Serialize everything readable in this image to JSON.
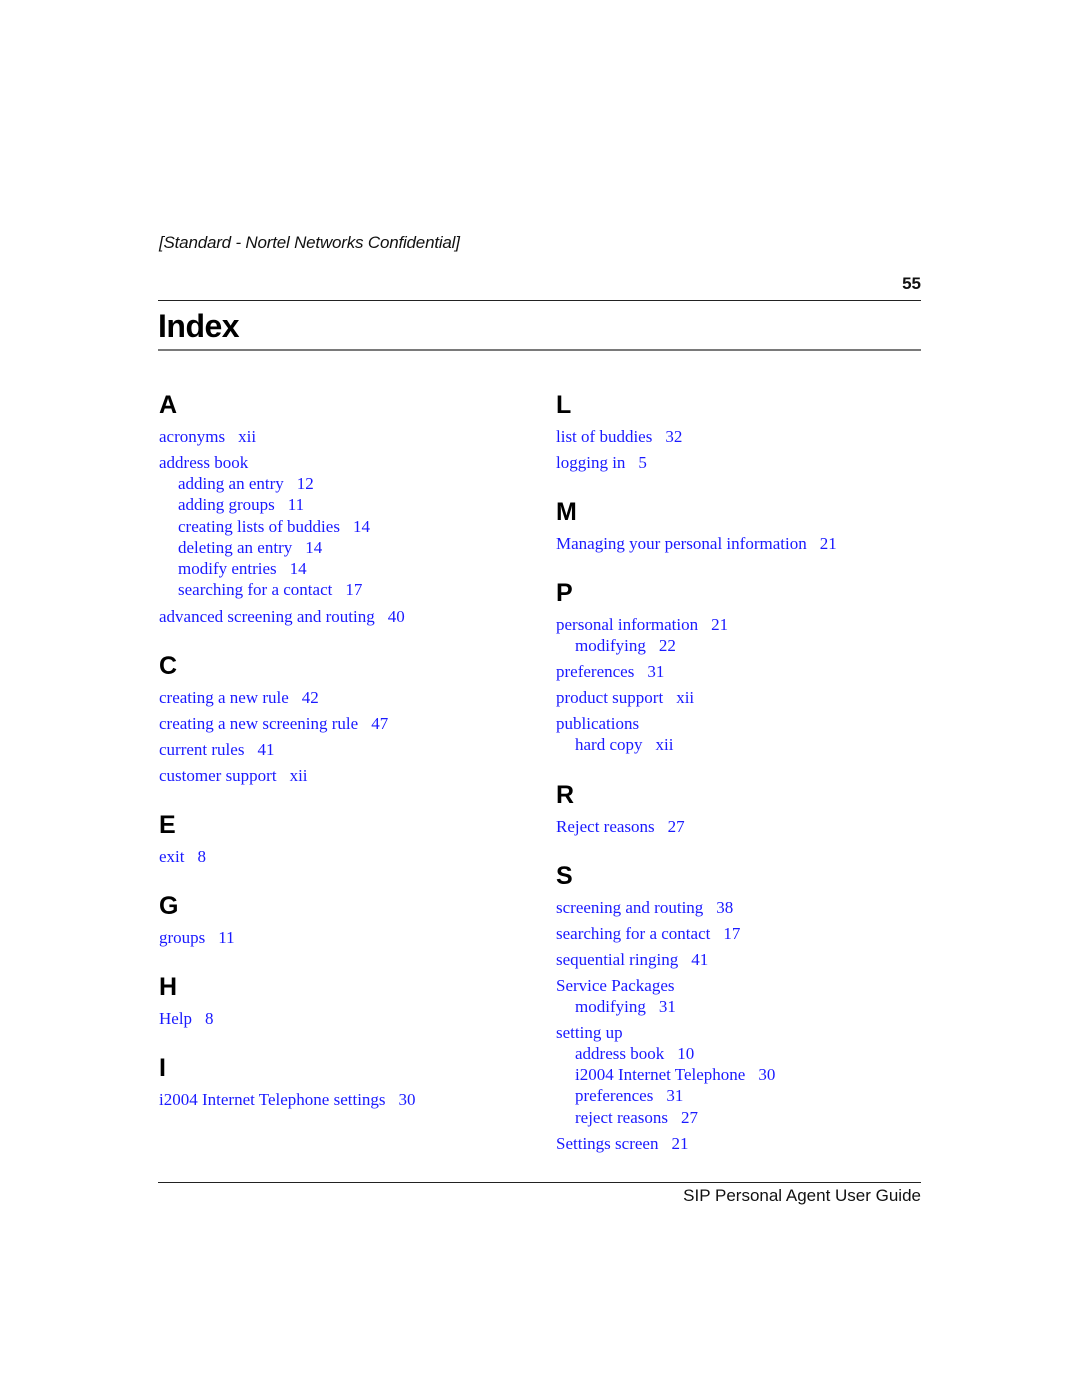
{
  "header": {
    "confidential": "[Standard - Nortel Networks Confidential]",
    "page_number": "55",
    "title": "Index"
  },
  "footer": {
    "guide_title": "SIP Personal Agent User Guide"
  },
  "colors": {
    "link": "#1a1aff",
    "heading": "#000000"
  },
  "left_column": [
    {
      "letter": "A",
      "entries": [
        {
          "term": "acronyms",
          "page": "xii",
          "subs": []
        },
        {
          "term": "address book",
          "page": "",
          "subs": [
            {
              "term": "adding an entry",
              "page": "12"
            },
            {
              "term": "adding groups",
              "page": "11"
            },
            {
              "term": "creating lists of buddies",
              "page": "14"
            },
            {
              "term": "deleting an entry",
              "page": "14"
            },
            {
              "term": "modify entries",
              "page": "14"
            },
            {
              "term": "searching for a contact",
              "page": "17"
            }
          ]
        },
        {
          "term": "advanced screening and routing",
          "page": "40",
          "subs": []
        }
      ]
    },
    {
      "letter": "C",
      "entries": [
        {
          "term": "creating a new rule",
          "page": "42",
          "subs": []
        },
        {
          "term": "creating a new screening rule",
          "page": "47",
          "subs": []
        },
        {
          "term": "current rules",
          "page": "41",
          "subs": []
        },
        {
          "term": "customer support",
          "page": "xii",
          "subs": []
        }
      ]
    },
    {
      "letter": "E",
      "entries": [
        {
          "term": "exit",
          "page": "8",
          "subs": []
        }
      ]
    },
    {
      "letter": "G",
      "entries": [
        {
          "term": "groups",
          "page": "11",
          "subs": []
        }
      ]
    },
    {
      "letter": "H",
      "entries": [
        {
          "term": "Help",
          "page": "8",
          "subs": []
        }
      ]
    },
    {
      "letter": "I",
      "entries": [
        {
          "term": "i2004 Internet Telephone settings",
          "page": "30",
          "subs": []
        }
      ]
    }
  ],
  "right_column": [
    {
      "letter": "L",
      "entries": [
        {
          "term": "list of buddies",
          "page": "32",
          "subs": []
        },
        {
          "term": "logging in",
          "page": "5",
          "subs": []
        }
      ]
    },
    {
      "letter": "M",
      "entries": [
        {
          "term": "Managing your personal information",
          "page": "21",
          "subs": []
        }
      ]
    },
    {
      "letter": "P",
      "entries": [
        {
          "term": "personal information",
          "page": "21",
          "subs": [
            {
              "term": "modifying",
              "page": "22"
            }
          ]
        },
        {
          "term": "preferences",
          "page": "31",
          "subs": []
        },
        {
          "term": "product support",
          "page": "xii",
          "subs": []
        },
        {
          "term": "publications",
          "page": "",
          "subs": [
            {
              "term": "hard copy",
              "page": "xii"
            }
          ]
        }
      ]
    },
    {
      "letter": "R",
      "entries": [
        {
          "term": "Reject reasons",
          "page": "27",
          "subs": []
        }
      ]
    },
    {
      "letter": "S",
      "entries": [
        {
          "term": "screening and routing",
          "page": "38",
          "subs": []
        },
        {
          "term": "searching for a contact",
          "page": "17",
          "subs": []
        },
        {
          "term": "sequential ringing",
          "page": "41",
          "subs": []
        },
        {
          "term": "Service Packages",
          "page": "",
          "subs": [
            {
              "term": "modifying",
              "page": "31"
            }
          ]
        },
        {
          "term": "setting up",
          "page": "",
          "subs": [
            {
              "term": "address book",
              "page": "10"
            },
            {
              "term": "i2004 Internet Telephone",
              "page": "30"
            },
            {
              "term": "preferences",
              "page": "31"
            },
            {
              "term": "reject reasons",
              "page": "27"
            }
          ]
        },
        {
          "term": "Settings screen",
          "page": "21",
          "subs": []
        }
      ]
    }
  ]
}
